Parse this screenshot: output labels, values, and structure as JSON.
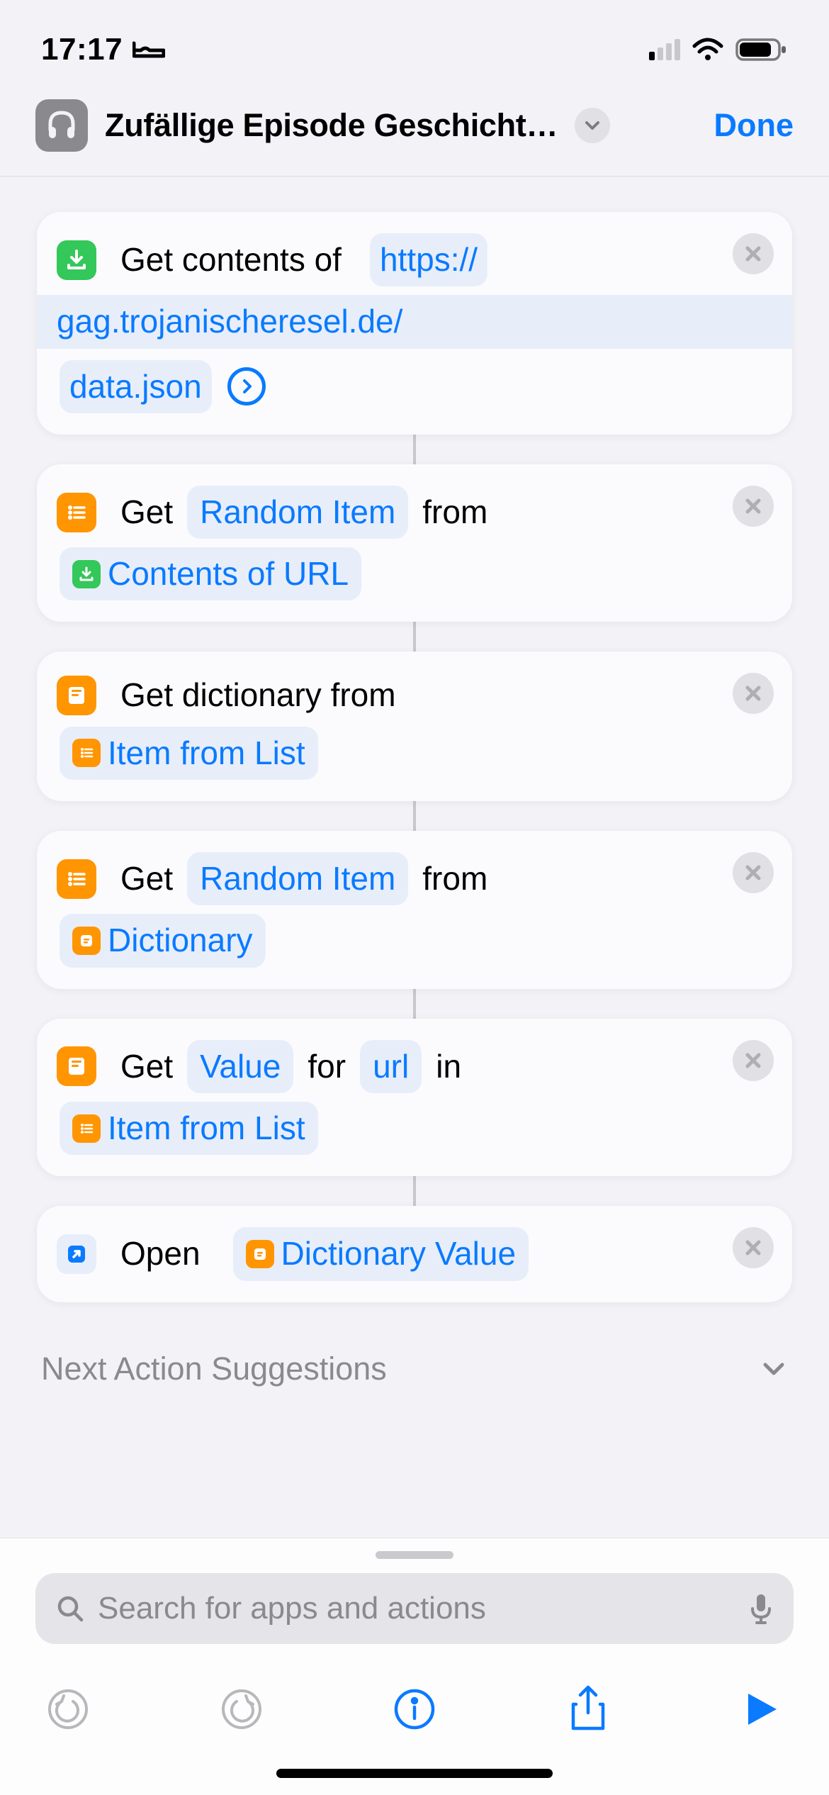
{
  "status": {
    "time": "17:17",
    "sleep_icon": "bed-icon",
    "signal_bars_on": 1,
    "signal_bars_total": 4,
    "wifi": true,
    "battery_level": 0.78
  },
  "header": {
    "app_icon": "headphones-icon",
    "title": "Zufällige Episode Geschicht…",
    "chevron": "chevron-down-icon",
    "done_label": "Done"
  },
  "actions": [
    {
      "icon": "download-icon",
      "icon_color": "green",
      "leading_text": "Get contents of",
      "url_parts": [
        "https://",
        "gag.trojanischeresel.de/",
        "data.json"
      ],
      "expandable": true
    },
    {
      "icon": "list-icon",
      "icon_color": "orange",
      "leading_text": "Get",
      "param": "Random Item",
      "mid_text": "from",
      "var_icon": "download-icon",
      "var_icon_color": "green",
      "var_label": "Contents of URL"
    },
    {
      "icon": "book-icon",
      "icon_color": "orange",
      "leading_text": "Get dictionary from",
      "var_icon": "list-icon",
      "var_icon_color": "orange",
      "var_label": "Item from List"
    },
    {
      "icon": "list-icon",
      "icon_color": "orange",
      "leading_text": "Get",
      "param": "Random Item",
      "mid_text": "from",
      "var_icon": "box-icon",
      "var_icon_color": "orange",
      "var_label": "Dictionary"
    },
    {
      "icon": "book-icon",
      "icon_color": "orange",
      "leading_text": "Get",
      "param": "Value",
      "mid_text": "for",
      "key_param": "url",
      "tail_text": "in",
      "var_icon": "list-icon",
      "var_icon_color": "orange",
      "var_label": "Item from List"
    },
    {
      "icon": "arrow-out-icon",
      "icon_color": "blue",
      "leading_text": "Open",
      "var_icon": "box-icon",
      "var_icon_color": "orange",
      "var_label": "Dictionary Value"
    }
  ],
  "suggestions": {
    "label": "Next Action Suggestions",
    "chevron": "chevron-down-icon"
  },
  "bottom": {
    "search_placeholder": "Search for apps and actions",
    "toolbar": {
      "undo": "undo-icon",
      "redo": "redo-icon",
      "info": "info-icon",
      "share": "share-icon",
      "play": "play-icon"
    }
  }
}
